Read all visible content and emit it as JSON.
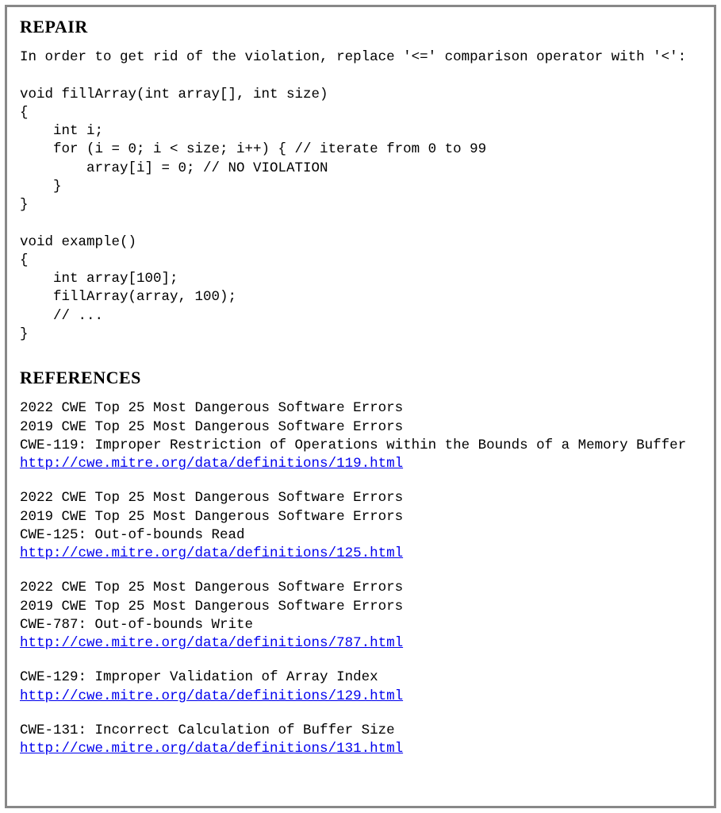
{
  "repair": {
    "heading": "REPAIR",
    "intro": "In order to get rid of the violation, replace '<=' comparison operator with '<':",
    "code": "void fillArray(int array[], int size)\n{\n    int i;\n    for (i = 0; i < size; i++) { // iterate from 0 to 99\n        array[i] = 0; // NO VIOLATION\n    }\n}\n\nvoid example()\n{\n    int array[100];\n    fillArray(array, 100);\n    // ...\n}"
  },
  "references": {
    "heading": "REFERENCES",
    "blocks": [
      {
        "lines": [
          "2022 CWE Top 25 Most Dangerous Software Errors",
          "2019 CWE Top 25 Most Dangerous Software Errors",
          "CWE-119: Improper Restriction of Operations within the Bounds of a Memory Buffer"
        ],
        "link": "http://cwe.mitre.org/data/definitions/119.html"
      },
      {
        "lines": [
          "2022 CWE Top 25 Most Dangerous Software Errors",
          "2019 CWE Top 25 Most Dangerous Software Errors",
          "CWE-125: Out-of-bounds Read"
        ],
        "link": "http://cwe.mitre.org/data/definitions/125.html"
      },
      {
        "lines": [
          "2022 CWE Top 25 Most Dangerous Software Errors",
          "2019 CWE Top 25 Most Dangerous Software Errors",
          "CWE-787: Out-of-bounds Write"
        ],
        "link": "http://cwe.mitre.org/data/definitions/787.html"
      },
      {
        "lines": [
          "CWE-129: Improper Validation of Array Index"
        ],
        "link": "http://cwe.mitre.org/data/definitions/129.html"
      },
      {
        "lines": [
          "CWE-131: Incorrect Calculation of Buffer Size"
        ],
        "link": "http://cwe.mitre.org/data/definitions/131.html"
      }
    ]
  }
}
